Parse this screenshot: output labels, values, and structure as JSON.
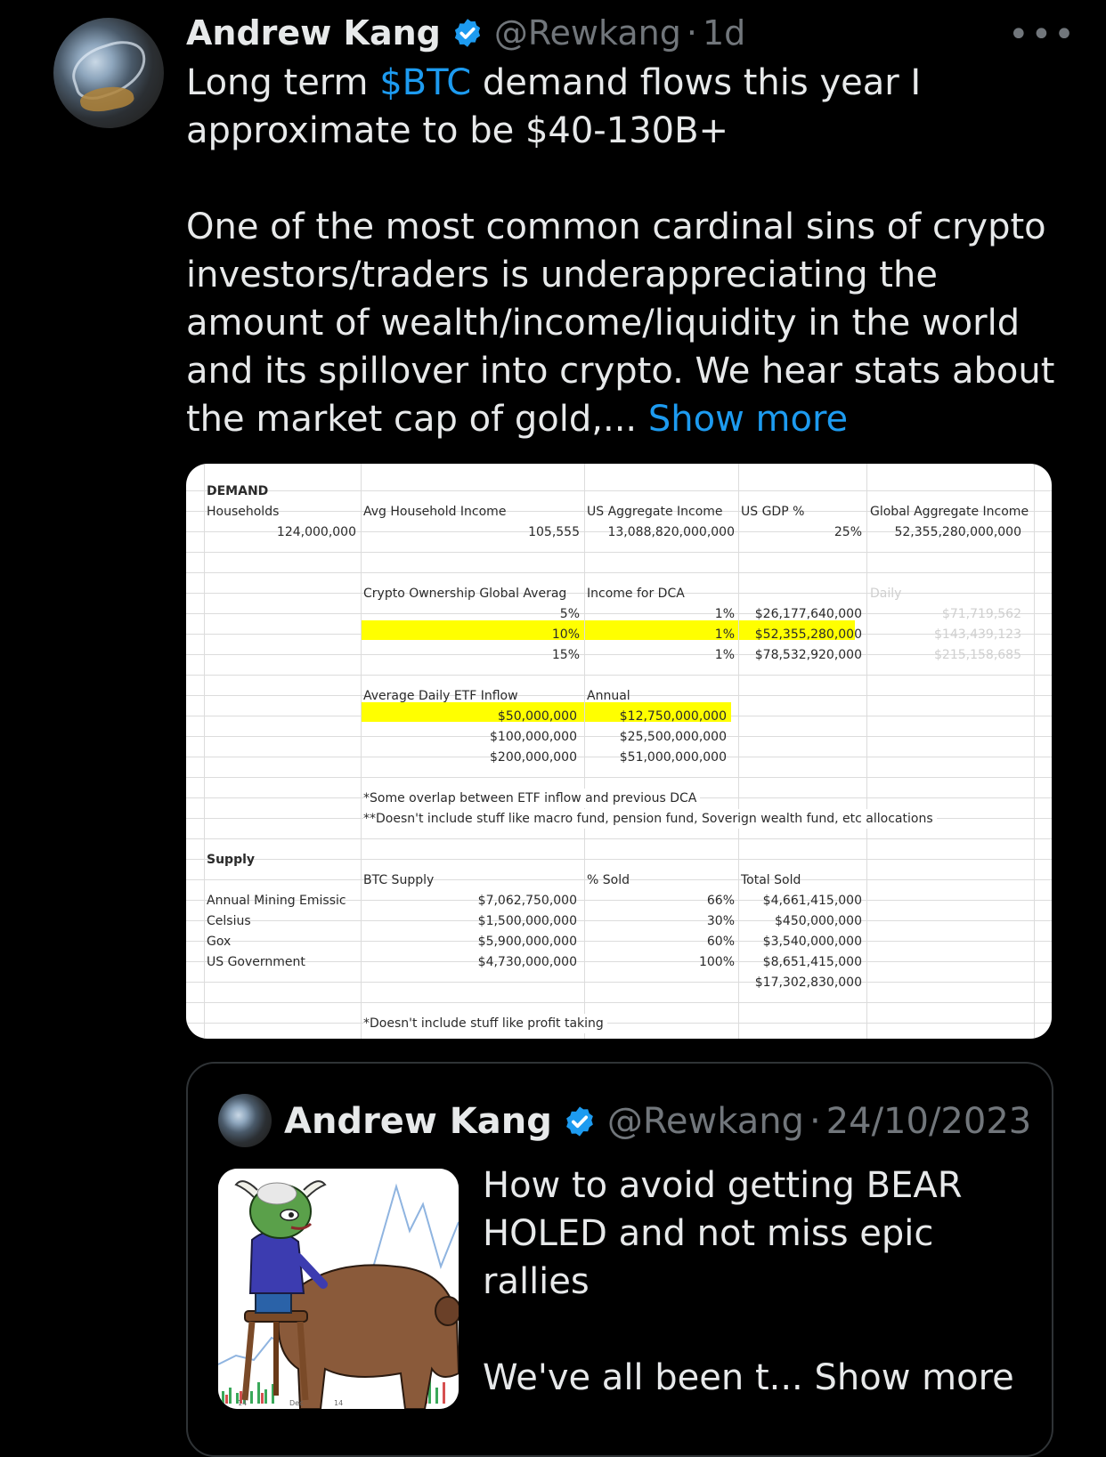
{
  "tweet": {
    "author_name": "Andrew Kang",
    "handle": "@Rewkang",
    "time": "1d",
    "more_label": "•••",
    "line1_pre": "Long term ",
    "cashtag": "$BTC",
    "line1_post": " demand flows this year I approximate to be $40-130B+",
    "para2": "One of the most common cardinal sins of crypto investors/traders is underappreciating the amount of wealth/income/liquidity in the world and its spillover into crypto. We hear stats about the market cap of gold,... ",
    "show_more": "Show more"
  },
  "sheet": {
    "demand_label": "DEMAND",
    "households_label": "Households",
    "households_value": "124,000,000",
    "avg_income_label": "Avg Household Income",
    "avg_income_value": "105,555",
    "us_agg_label": "US Aggregate Income",
    "us_agg_value": "13,088,820,000,000",
    "gdp_label": "US GDP %",
    "gdp_value": "25%",
    "global_agg_label": "Global Aggregate Income",
    "global_agg_value": "52,355,280,000,000",
    "crypto_own_label": "Crypto Ownership Global Averag",
    "income_dca_label": "Income for DCA",
    "daily_label": "Daily",
    "dca_rows": [
      {
        "own": "5%",
        "pct": "1%",
        "amt": "$26,177,640,000",
        "daily": "$71,719,562"
      },
      {
        "own": "10%",
        "pct": "1%",
        "amt": "$52,355,280,000",
        "daily": "$143,439,123"
      },
      {
        "own": "15%",
        "pct": "1%",
        "amt": "$78,532,920,000",
        "daily": "$215,158,685"
      }
    ],
    "etf_label": "Average Daily ETF Inflow",
    "annual_label": "Annual",
    "etf_rows": [
      {
        "daily": "$50,000,000",
        "annual": "$12,750,000,000"
      },
      {
        "daily": "$100,000,000",
        "annual": "$25,500,000,000"
      },
      {
        "daily": "$200,000,000",
        "annual": "$51,000,000,000"
      }
    ],
    "note1": "*Some overlap between ETF inflow and previous DCA",
    "note2": "**Doesn't include stuff like macro fund, pension fund, Soverign wealth fund, etc allocations",
    "supply_label": "Supply",
    "btc_supply_label": "BTC Supply",
    "pct_sold_label": "% Sold",
    "total_sold_label": "Total Sold",
    "supply_rows": [
      {
        "name": "Annual Mining Emissic",
        "supply": "$7,062,750,000",
        "pct": "66%",
        "total": "$4,661,415,000"
      },
      {
        "name": "Celsius",
        "supply": "$1,500,000,000",
        "pct": "30%",
        "total": "$450,000,000"
      },
      {
        "name": "Gox",
        "supply": "$5,900,000,000",
        "pct": "60%",
        "total": "$3,540,000,000"
      },
      {
        "name": "US Government",
        "supply": "$4,730,000,000",
        "pct": "100%",
        "total": "$8,651,415,000"
      }
    ],
    "grand_total": "$17,302,830,000",
    "note3": "*Doesn't include stuff like profit taking",
    "highlight_color": "#ffff00"
  },
  "quote": {
    "author_name": "Andrew Kang",
    "handle": "@Rewkang",
    "date": "24/10/2023",
    "text1": "How to avoid getting BEAR HOLED and not miss epic rallies",
    "text2": "We've all been t... ",
    "show_more": "Show more"
  },
  "colors": {
    "background": "#000000",
    "text": "#e7e9ea",
    "muted": "#71767b",
    "link": "#1d9bf0",
    "verified": "#1d9bf0",
    "border": "#2f3336"
  }
}
